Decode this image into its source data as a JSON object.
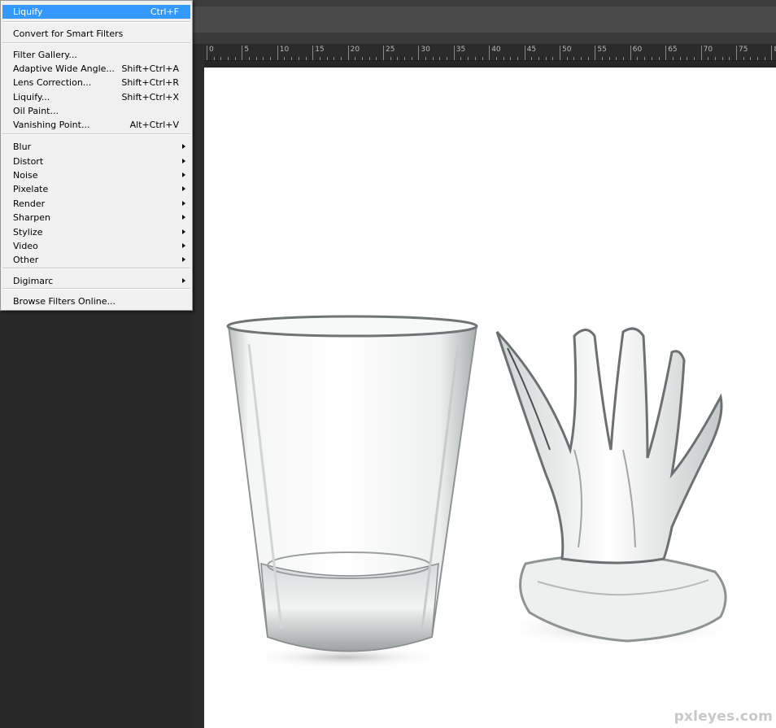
{
  "menu": {
    "items": [
      {
        "label": "Liquify",
        "shortcut": "Ctrl+F",
        "highlight": true
      },
      {
        "label": "Convert for Smart Filters",
        "shortcut": ""
      },
      {
        "label": "Filter Gallery...",
        "shortcut": ""
      },
      {
        "label": "Adaptive Wide Angle...",
        "shortcut": "Shift+Ctrl+A"
      },
      {
        "label": "Lens Correction...",
        "shortcut": "Shift+Ctrl+R"
      },
      {
        "label": "Liquify...",
        "shortcut": "Shift+Ctrl+X"
      },
      {
        "label": "Oil Paint...",
        "shortcut": ""
      },
      {
        "label": "Vanishing Point...",
        "shortcut": "Alt+Ctrl+V"
      },
      {
        "label": "Blur",
        "submenu": true
      },
      {
        "label": "Distort",
        "submenu": true
      },
      {
        "label": "Noise",
        "submenu": true
      },
      {
        "label": "Pixelate",
        "submenu": true
      },
      {
        "label": "Render",
        "submenu": true
      },
      {
        "label": "Sharpen",
        "submenu": true
      },
      {
        "label": "Stylize",
        "submenu": true
      },
      {
        "label": "Video",
        "submenu": true
      },
      {
        "label": "Other",
        "submenu": true
      },
      {
        "label": "Digimarc",
        "submenu": true
      },
      {
        "label": "Browse Filters Online...",
        "shortcut": ""
      }
    ]
  },
  "ruler": {
    "labels": [
      "0",
      "5",
      "10",
      "15",
      "20",
      "25",
      "30",
      "35",
      "40",
      "45",
      "50",
      "55",
      "60",
      "65",
      "70",
      "75",
      "8"
    ]
  },
  "canvas": {
    "watermark": "pxleyes.com"
  },
  "colors": {
    "highlight": "#3399ff",
    "workspace": "#282828",
    "menu_bg": "#f0f0f0"
  }
}
